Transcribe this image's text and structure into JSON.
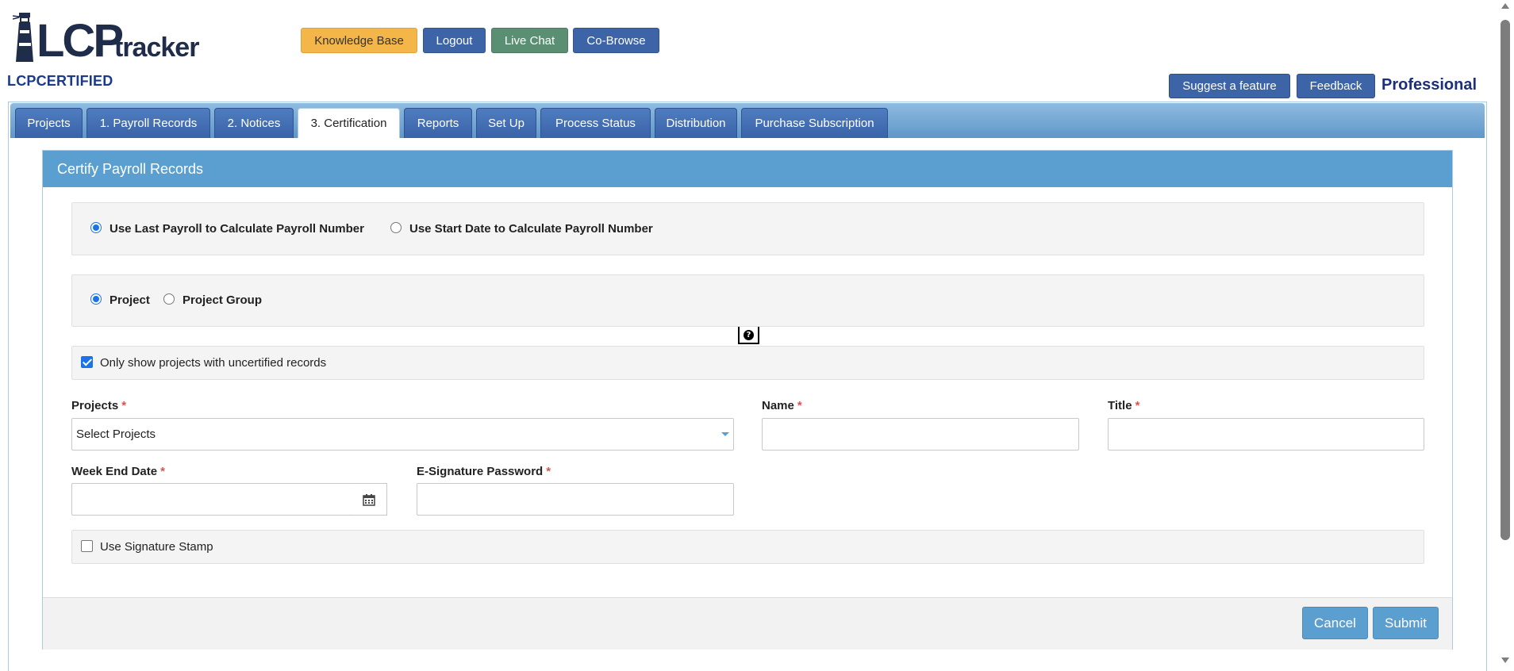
{
  "header": {
    "logo_main": "LCP",
    "logo_sub": "tracker",
    "account_name": "LCPCERTIFIED",
    "plan_label": "Professional",
    "buttons": {
      "knowledge_base": "Knowledge Base",
      "logout": "Logout",
      "live_chat": "Live Chat",
      "co_browse": "Co-Browse",
      "suggest_feature": "Suggest a feature",
      "feedback": "Feedback"
    }
  },
  "tabs": [
    {
      "label": "Projects",
      "active": false
    },
    {
      "label": "1. Payroll Records",
      "active": false
    },
    {
      "label": "2. Notices",
      "active": false
    },
    {
      "label": "3. Certification",
      "active": true
    },
    {
      "label": "Reports",
      "active": false
    },
    {
      "label": "Set Up",
      "active": false
    },
    {
      "label": "Process Status",
      "active": false
    },
    {
      "label": "Distribution",
      "active": false
    },
    {
      "label": "Purchase Subscription",
      "active": false
    }
  ],
  "panel": {
    "title": "Certify Payroll Records",
    "payroll_number_options": {
      "option_last_payroll": "Use Last Payroll to Calculate Payroll Number",
      "option_start_date": "Use Start Date to Calculate Payroll Number",
      "selected": "last_payroll"
    },
    "scope_options": {
      "option_project": "Project",
      "option_project_group": "Project Group",
      "selected": "project"
    },
    "uncertified_filter": {
      "label": "Only show projects with uncertified records",
      "checked": true
    },
    "fields": {
      "projects_label": "Projects",
      "projects_value": "Select Projects",
      "name_label": "Name",
      "name_value": "",
      "title_label": "Title",
      "title_value": "",
      "week_end_label": "Week End Date",
      "week_end_value": "",
      "esig_label": "E-Signature Password",
      "esig_value": "",
      "required_marker": "*"
    },
    "signature_stamp": {
      "label": "Use Signature Stamp",
      "checked": false
    },
    "actions": {
      "cancel": "Cancel",
      "submit": "Submit"
    }
  },
  "colors": {
    "primary_blue": "#3c64a6",
    "panel_header": "#5b9fd0",
    "knowledge_base": "#f5b649",
    "live_chat": "#5b8f74",
    "required": "#d9534f"
  },
  "icons": [
    "lighthouse-icon",
    "help-icon",
    "calendar-icon",
    "chevron-down-icon"
  ]
}
